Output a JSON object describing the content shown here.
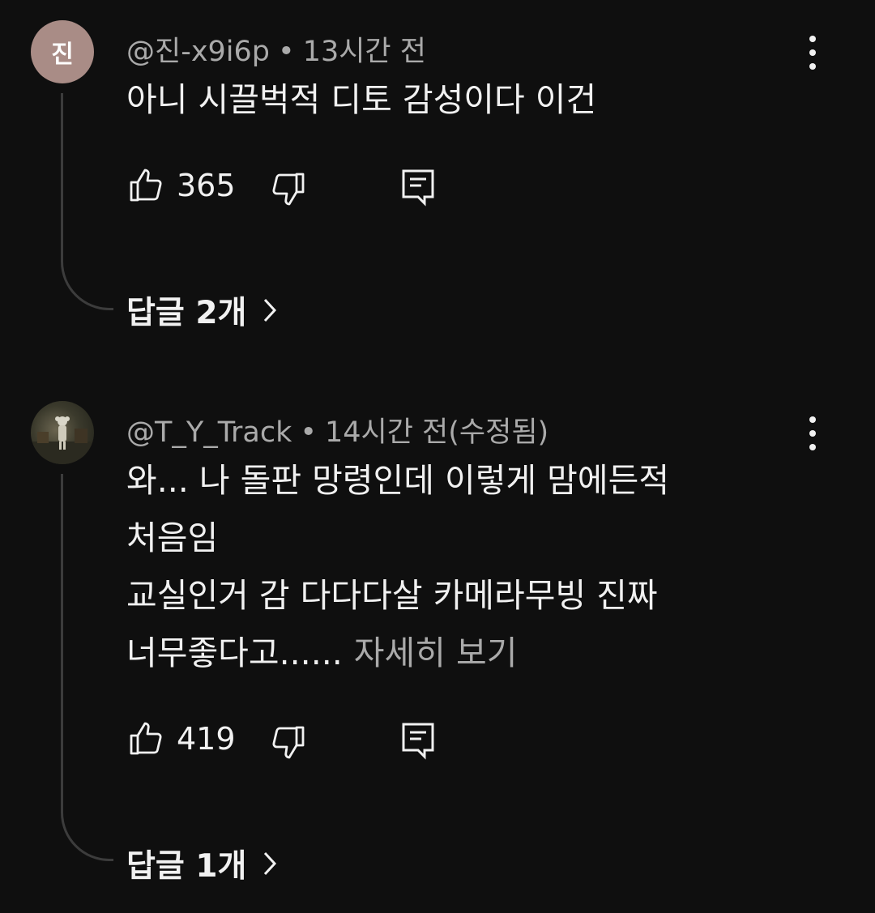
{
  "comments": [
    {
      "avatar_letter": "진",
      "author": "@진-x9i6p",
      "separator": "•",
      "time": "13시간 전",
      "lines": [
        "아니 시끌벅적 디토 감성이다 이건"
      ],
      "more": "",
      "likes": "365",
      "replies": "답글 2개"
    },
    {
      "avatar_letter": "",
      "author": "@T_Y_Track",
      "separator": "•",
      "time": "14시간 전(수정됨)",
      "lines": [
        "와... 나 돌판 망령인데 이렇게 맘에든적",
        "처음임",
        "교실인거 감 다다다살 카메라무빙 진짜",
        "너무좋다고......"
      ],
      "more": "자세히 보기",
      "likes": "419",
      "replies": "답글 1개"
    }
  ],
  "icons": {
    "like": "thumbs-up-icon",
    "dislike": "thumbs-down-icon",
    "reply": "comment-icon",
    "menu": "more-vert-icon",
    "chevron": "chevron-right-icon"
  },
  "colors": {
    "background": "#0f0f0f",
    "text": "#f1f1f1",
    "secondary": "#aaaaaa"
  }
}
